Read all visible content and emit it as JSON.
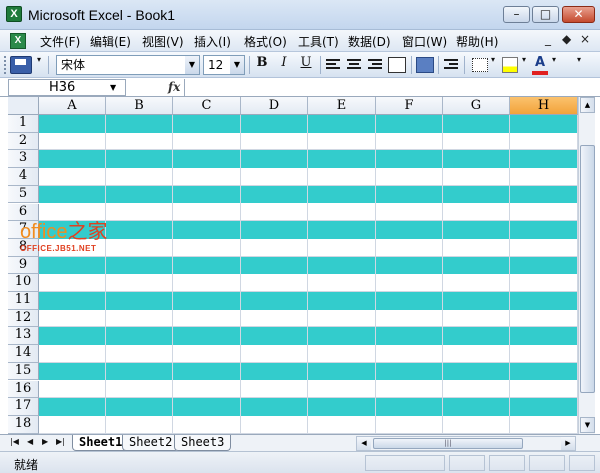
{
  "window": {
    "title": "Microsoft Excel - Book1",
    "minimize": "–",
    "maximize": "□",
    "close": "✕",
    "app_icon": "excel-icon"
  },
  "menu": {
    "items": [
      "文件(F)",
      "编辑(E)",
      "视图(V)",
      "插入(I)",
      "格式(O)",
      "工具(T)",
      "数据(D)",
      "窗口(W)",
      "帮助(H)"
    ],
    "controls": [
      "_",
      "◆",
      "×"
    ]
  },
  "toolbar": {
    "font_name": "宋体",
    "font_size": "12",
    "bold": "B",
    "italic": "I",
    "underline": "U",
    "font_color": "A"
  },
  "formula_bar": {
    "name_box": "H36",
    "fx": "fx",
    "value": ""
  },
  "grid": {
    "columns": [
      "A",
      "B",
      "C",
      "D",
      "E",
      "F",
      "G",
      "H"
    ],
    "active_column": "H",
    "rows": [
      "1",
      "2",
      "3",
      "4",
      "5",
      "6",
      "7",
      "8",
      "9",
      "10",
      "11",
      "12",
      "13",
      "14",
      "15",
      "16",
      "17",
      "18"
    ],
    "band_color": "#33cccc",
    "banded_rows": "odd"
  },
  "sheets": {
    "tabs": [
      "Sheet1",
      "Sheet2",
      "Sheet3"
    ],
    "active": "Sheet1"
  },
  "status": {
    "text": "就绪"
  },
  "watermark": {
    "main_a": "office",
    "main_b": "之家",
    "sub": "OFFICE.JB51.NET"
  }
}
